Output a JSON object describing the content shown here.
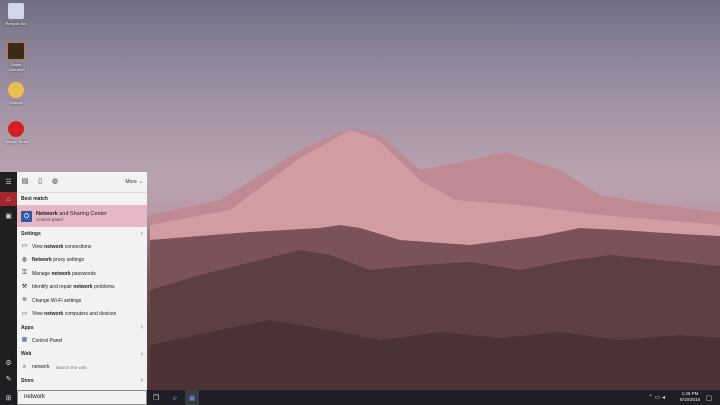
{
  "desktop": {
    "icons": [
      {
        "label": "Recycle Bin",
        "color": "#cfd8e6"
      },
      {
        "label": "Doom Collection",
        "color": "#3a2a1a"
      },
      {
        "label": "Outlook",
        "color": "#e8c050"
      },
      {
        "label": "Tomato Timer",
        "color": "#d42020"
      }
    ]
  },
  "start_menu": {
    "toolbar": {
      "more_label": "More"
    },
    "best_match": {
      "header": "Best match",
      "title_pre": "Network",
      "title_rest": " and Sharing Center",
      "subtitle": "Control panel"
    },
    "settings": {
      "header": "Settings",
      "items": [
        {
          "pre": "View ",
          "bold": "network",
          "post": " connections"
        },
        {
          "pre": "",
          "bold": "Network",
          "post": " proxy settings"
        },
        {
          "pre": "Manage ",
          "bold": "network",
          "post": " passwords"
        },
        {
          "pre": "Identify and repair ",
          "bold": "network",
          "post": " problems"
        },
        {
          "pre": "Change Wi-Fi settings",
          "bold": "",
          "post": ""
        },
        {
          "pre": "View ",
          "bold": "network",
          "post": " computers and devices"
        }
      ]
    },
    "apps": {
      "header": "Apps",
      "items": [
        {
          "label": "Control Panel"
        }
      ]
    },
    "web": {
      "header": "Web",
      "query": "network",
      "sub": "Search the web"
    },
    "store": {
      "header": "Store"
    }
  },
  "taskbar": {
    "search_value": "network",
    "time": "1:46 PM",
    "date": "9/19/2016"
  }
}
